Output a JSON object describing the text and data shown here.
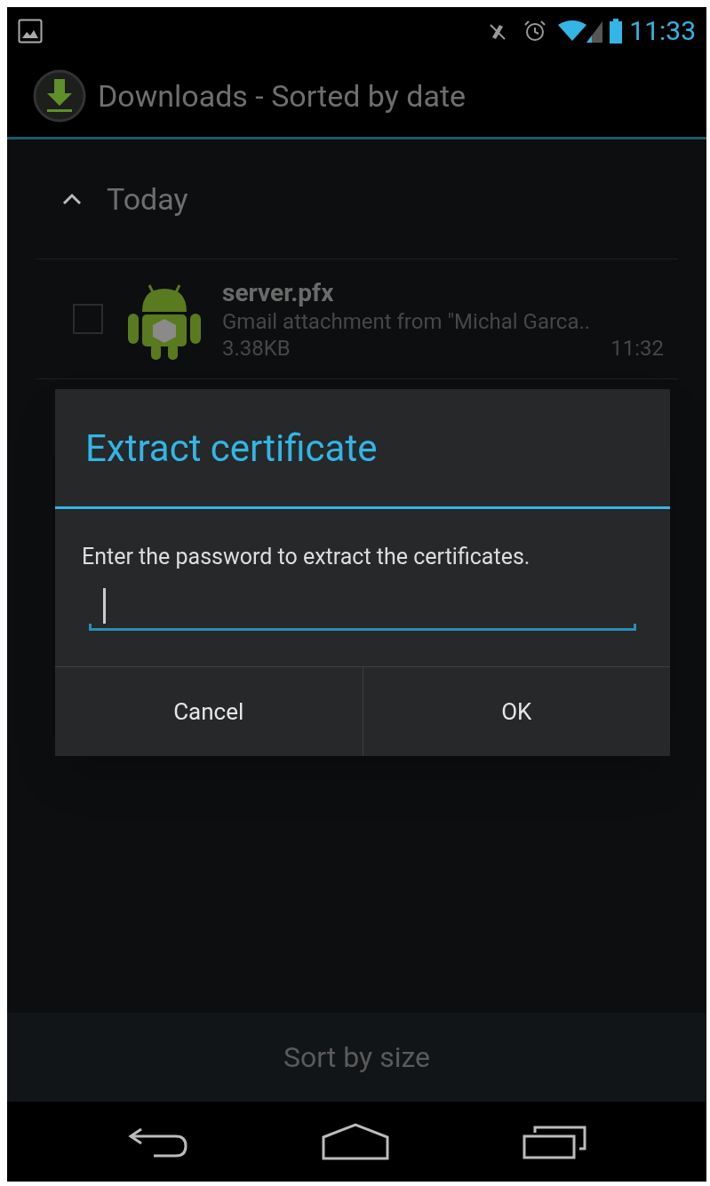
{
  "status_bar": {
    "time": "11:33"
  },
  "action_bar": {
    "title": "Downloads - Sorted by date"
  },
  "groups": [
    {
      "label": "Today",
      "expanded": true,
      "items": [
        {
          "name": "server.pfx",
          "description": "Gmail attachment from \"Michal Garca..",
          "size": "3.38KB",
          "time": "11:32",
          "checked": false
        }
      ]
    }
  ],
  "dialog": {
    "title": "Extract certificate",
    "message": "Enter the password to extract the certificates.",
    "buttons": [
      "Cancel",
      "OK"
    ]
  },
  "footer": {
    "button": "Sort by size"
  }
}
